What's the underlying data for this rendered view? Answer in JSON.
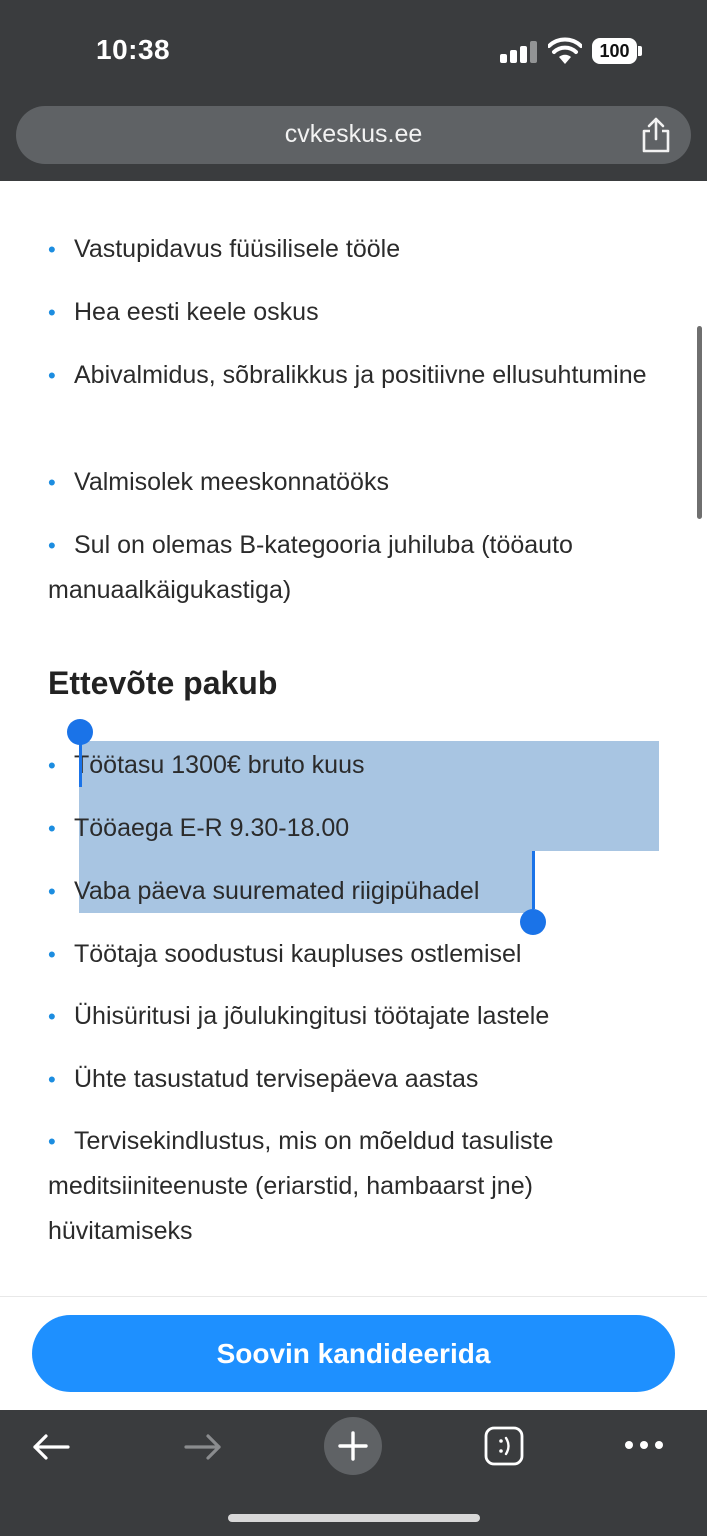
{
  "status_bar": {
    "time": "10:38",
    "battery": "100"
  },
  "browser": {
    "url": "cvkeskus.ee",
    "share_icon": "share-icon",
    "toolbar_icons": [
      "back-arrow-icon",
      "forward-arrow-icon",
      "new-tab-plus-icon",
      "tabs-icon",
      "more-icon"
    ]
  },
  "requirements": {
    "items": [
      "Vastupidavus füüsilisele tööle",
      "Hea eesti keele oskus",
      "Abivalmidus, sõbralikkus ja positiivne ellusuhtumine",
      "Valmisolek meeskonnatööks",
      "Sul on olemas B-kategooria juhiluba (tööauto manuaalkäigukastiga)"
    ]
  },
  "offers": {
    "title": "Ettevõte pakub",
    "items": [
      "Töötasu 1300€ bruto kuus",
      "Tööaega E-R 9.30-18.00",
      "Vaba päeva suuremated riigipühadel",
      "Töötaja soodustusi kaupluses ostlemisel",
      "Ühisüritusi ja jõulukingitusi töötajate lastele",
      "Ühte tasustatud tervisepäeva aastas",
      "Tervisekindlustus, mis on mõeldud tasuliste meditsiiniteenuste (eriarstid, hambaarst jne) hüvitamiseks"
    ]
  },
  "apply": {
    "label": "Soovin kandideerida"
  },
  "colors": {
    "accent": "#1e90ff",
    "bullet": "#1c8de0",
    "selection": "#a8c5e2",
    "chrome": "#3a3c3e"
  }
}
